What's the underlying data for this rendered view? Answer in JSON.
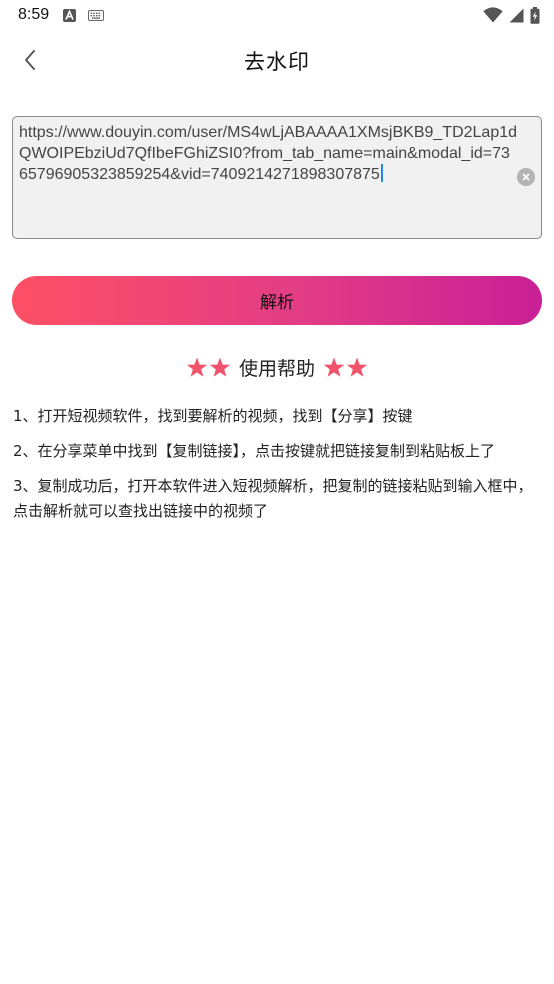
{
  "status_bar": {
    "time": "8:59",
    "left_icons": [
      "font-a-icon",
      "keyboard-icon"
    ],
    "right_icons": [
      "wifi-icon",
      "signal-icon",
      "battery-icon"
    ]
  },
  "header": {
    "title": "去水印",
    "back_icon": "chevron-left-icon"
  },
  "url_input": {
    "value": "https://www.douyin.com/user/MS4wLjABAAAA1XMsjBKB9_TD2Lap1dQWOIPEbziUd7QfIbeFGhiZSI0?from_tab_name=main&modal_id=7365796905323859254&vid=7409214271898307875",
    "clear_icon": "clear-circle-icon"
  },
  "parse_button": {
    "label": "解析"
  },
  "help": {
    "title": "使用帮助",
    "star_color": "#f1526c",
    "items": [
      "1、打开短视频软件，找到要解析的视频，找到【分享】按键",
      "2、在分享菜单中找到【复制链接】，点击按键就把链接复制到粘贴板上了",
      "3、复制成功后，打开本软件进入短视频解析，把复制的链接粘贴到输入框中，点击解析就可以查找出链接中的视频了"
    ]
  }
}
